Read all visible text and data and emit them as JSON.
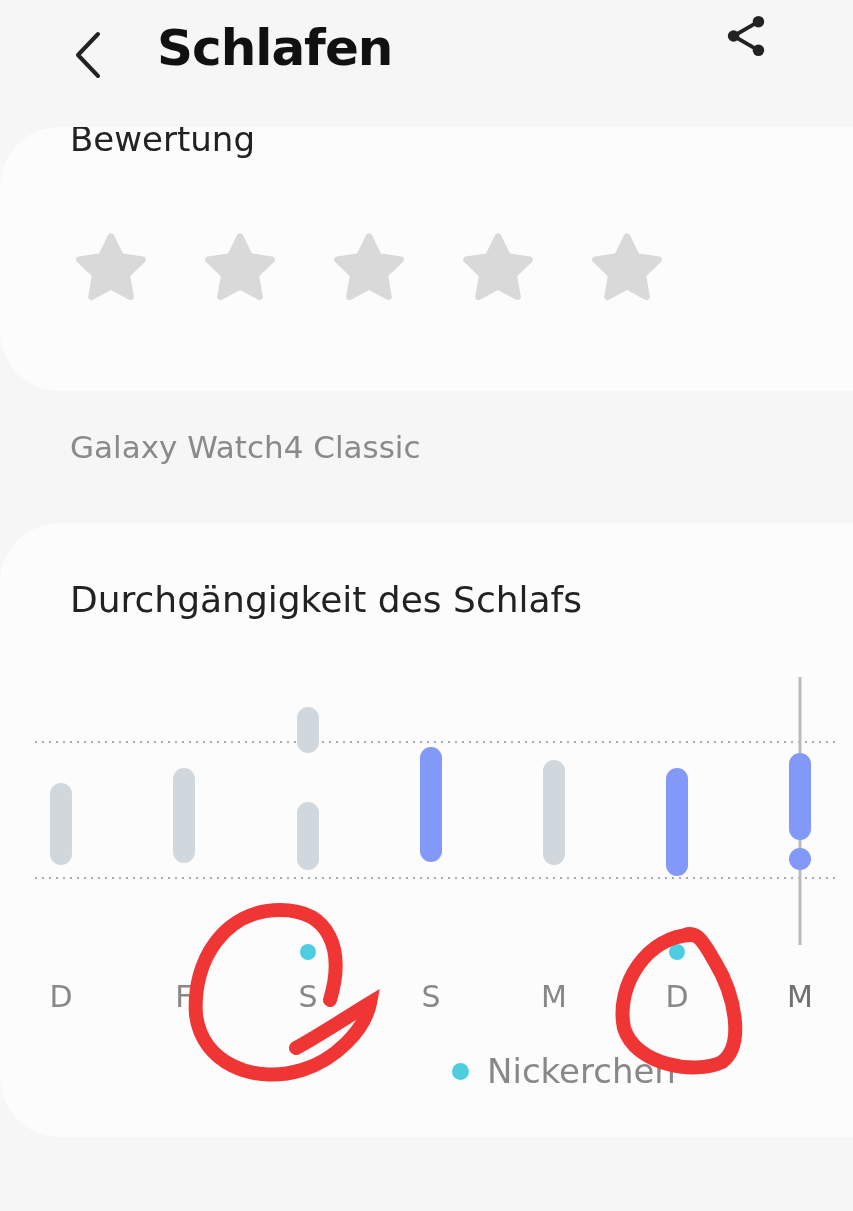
{
  "header": {
    "title": "Schlafen"
  },
  "rating": {
    "title": "Bewertung",
    "stars": 0
  },
  "device": "Galaxy Watch4 Classic",
  "consistency": {
    "title": "Durchgängigkeit des Schlafs",
    "days": [
      {
        "label": "D",
        "highlighted": false,
        "nap": false,
        "selected": false
      },
      {
        "label": "F",
        "highlighted": false,
        "nap": false,
        "selected": false
      },
      {
        "label": "S",
        "highlighted": false,
        "nap": true,
        "selected": false
      },
      {
        "label": "S",
        "highlighted": true,
        "nap": false,
        "selected": false
      },
      {
        "label": "M",
        "highlighted": false,
        "nap": false,
        "selected": false
      },
      {
        "label": "D",
        "highlighted": true,
        "nap": true,
        "selected": false
      },
      {
        "label": "M",
        "highlighted": true,
        "nap": false,
        "selected": true
      }
    ],
    "legend": "Nickerchen"
  }
}
